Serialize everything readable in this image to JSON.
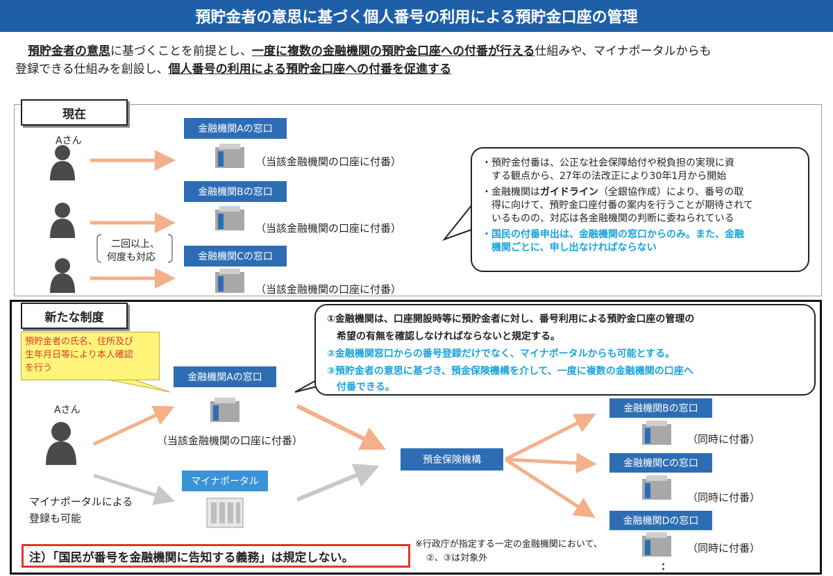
{
  "banner": {
    "title": "預貯金者の意思に基づく個人番号の利用による預貯金口座の管理"
  },
  "intro": {
    "l1_a": "預貯金者の意思",
    "l1_b": "に基づくことを前提とし、",
    "l1_c": "一度に複数の金融機関の預貯金口座への付番が行える",
    "l1_d": "仕組みや、マイナポータルからも",
    "l2_a": "登録できる仕組みを創設し、",
    "l2_b": "個人番号の利用による預貯金口座への付番を促進する"
  },
  "current": {
    "tag": "現在",
    "person_label": "Aさん",
    "repeat_label_1": "二回以上、",
    "repeat_label_2": "何度も対応",
    "banks": [
      "金融機関Aの窓口",
      "金融機関Bの窓口",
      "金融機関Cの窓口"
    ],
    "account_note": "（当該金融機関の口座に付番）",
    "bubble": {
      "p1_1": "・預貯金付番は、公正な社会保障給付や税負担の実現に資",
      "p1_2": "　する観点から、27年の法改正により30年1月から開始",
      "p2_1a": "・金融機関は",
      "p2_1b": "ガイドライン",
      "p2_1c": "（全銀協作成）により、番号の取",
      "p2_2": "　得に向けて、預貯金口座付番の案内を行うことが期待されて",
      "p2_3": "　いるものの、対応は各金融機関の判断に委ねられている",
      "p3_1": "・国民の付番申出は、金融機関の窓口からのみ。また、金融",
      "p3_2": "　機関ごとに、申し出なければならない"
    }
  },
  "newsys": {
    "tag": "新たな制度",
    "id_check_1": "預貯金者の氏名、住所及び",
    "id_check_2": "生年月日等により本人確認",
    "id_check_3": "を行う",
    "person_label": "Aさん",
    "portal_note_1": "マイナポータルによる",
    "portal_note_2": "登録も可能",
    "bank_a": "金融機関Aの窓口",
    "account_note": "（当該金融機関の口座に付番）",
    "portal": "マイナポータル",
    "dic": "預金保険機構",
    "banks_right": [
      "金融機関Bの窓口",
      "金融機関Cの窓口",
      "金融機関Dの窓口"
    ],
    "simul": "（同時に付番）",
    "bubble": {
      "r1_1": "①金融機関は、口座開設時等に預貯金者に対し、番号利用による預貯金口座の管理の",
      "r1_2": "　希望の有無を確認しなければならないと規定する。",
      "r2": "②金融機関窓口からの番号登録だけでなく、マイナポータルからも可能とする。",
      "r3_1": "③預貯金者の意思に基づき、預金保険機構を介して、一度に複数の金融機関の口座へ",
      "r3_2": "　付番できる。"
    },
    "note": "注）「国民が番号を金融機関に告知する義務」は規定しない。",
    "footnote_1": "※行政庁が指定する一定の金融機関において、",
    "footnote_2": "②、③は対象外",
    "ellipsis": "："
  },
  "colors": {
    "banner": "#1f5fa8",
    "bank": "#2e6db4",
    "arrow_orange": "#f4b08a",
    "arrow_gray": "#c8c8c8",
    "cyan": "#1aa3dc",
    "red": "#e0352b"
  }
}
